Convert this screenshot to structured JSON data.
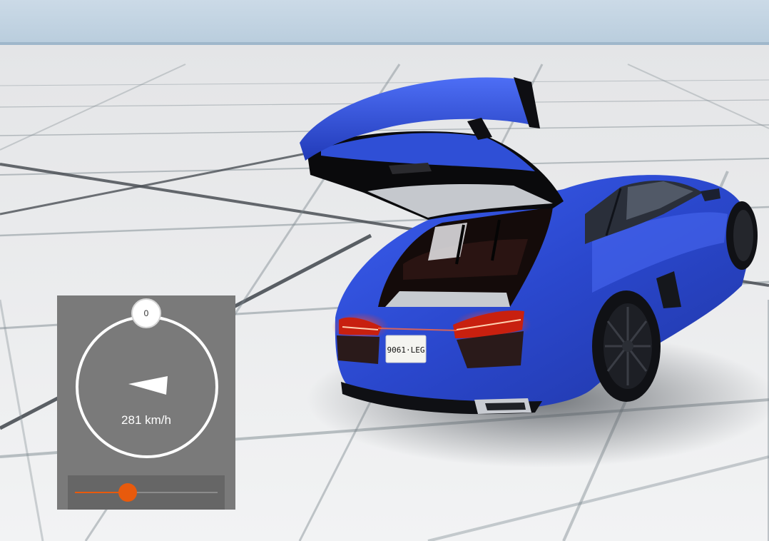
{
  "hud": {
    "heading_value": "0",
    "speed_text": "281 km/h",
    "slider_level_fraction": 0.37,
    "accent_color": "#e85a0c",
    "panel_color": "#7a7a7a"
  },
  "vehicle": {
    "license_plate": "9061·LEG",
    "body_color": "#2f4fd6"
  },
  "environment": {
    "sky_color": "#c5d6e4",
    "ground_color": "#e8eaec"
  }
}
